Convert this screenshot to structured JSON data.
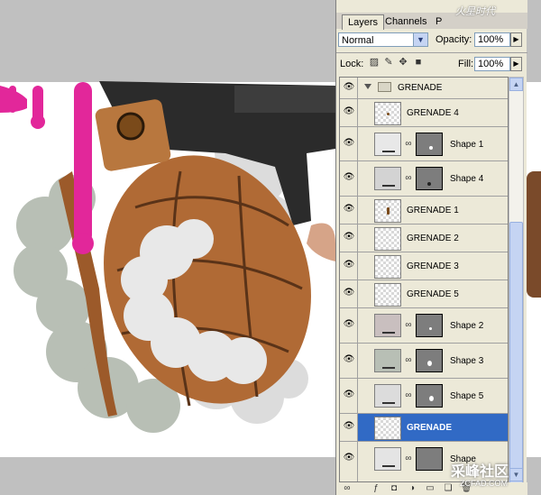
{
  "watermark_top": "火星时代",
  "watermark_bottom": {
    "brand": "采峰社区",
    "url": "ZCFAD.COM"
  },
  "layers_panel": {
    "tabs": [
      "Layers",
      "Channels",
      "P"
    ],
    "blend_mode": "Normal",
    "opacity_label": "Opacity:",
    "opacity_value": "100%",
    "lock_label": "Lock:",
    "fill_label": "Fill:",
    "fill_value": "100%",
    "layers": [
      {
        "name": "GRENADE",
        "kind": "group"
      },
      {
        "name": "GRENADE 4",
        "kind": "pixel"
      },
      {
        "name": "Shape 1",
        "kind": "shape"
      },
      {
        "name": "Shape 4",
        "kind": "shape"
      },
      {
        "name": "GRENADE 1",
        "kind": "pixel"
      },
      {
        "name": "GRENADE 2",
        "kind": "pixel"
      },
      {
        "name": "GRENADE 3",
        "kind": "pixel"
      },
      {
        "name": "GRENADE 5",
        "kind": "pixel"
      },
      {
        "name": "Shape 2",
        "kind": "shape"
      },
      {
        "name": "Shape 3",
        "kind": "shape"
      },
      {
        "name": "Shape 5",
        "kind": "shape"
      },
      {
        "name": "GRENADE",
        "kind": "pixel",
        "selected": true
      },
      {
        "name": "Shape",
        "kind": "shape"
      }
    ]
  },
  "colors": {
    "selection": "#316ac5",
    "panel_bg": "#ece9d8",
    "pink_drip": "#e2279a",
    "copper": "#b06a35",
    "smoke": "#e4e4e4",
    "smoke_back": "#b8bfb5"
  }
}
